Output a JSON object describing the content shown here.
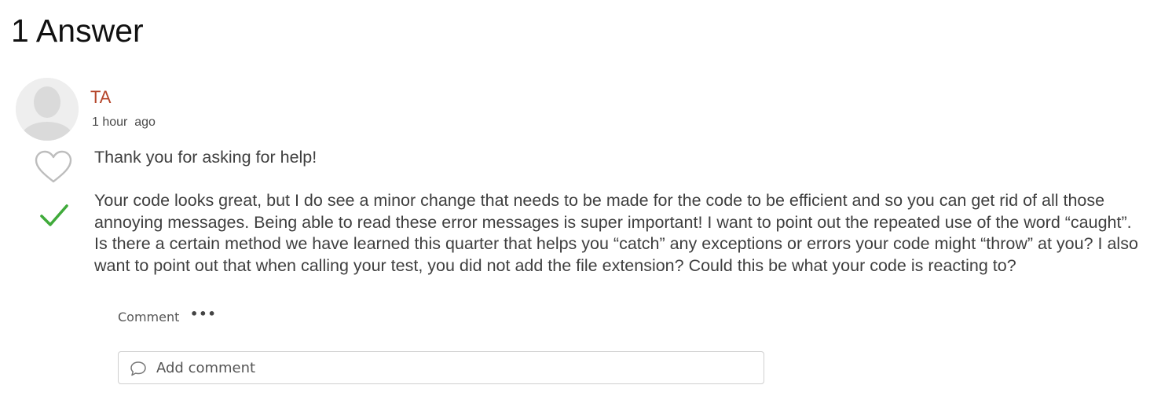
{
  "answers_header": {
    "title": "1 Answer"
  },
  "answer": {
    "author": {
      "name": "TA",
      "avatar_icon": "default-user-avatar"
    },
    "timestamp": "1 hour  ago",
    "actions": {
      "like_icon": "heart-outline-icon",
      "accepted_icon": "checkmark-icon",
      "accepted_color": "#3faa3a"
    },
    "body": {
      "paragraphs": [
        "Thank you for asking for help!",
        "Your code looks great, but I do see a minor change that needs to be made for the code to be efficient and so you can get rid of all those annoying messages. Being able to read these error messages is super important! I want to point out the repeated use of the word “caught”. Is there a certain method we have learned this quarter that helps you “catch” any exceptions or errors your code might “throw” at you? I also want to point out that when calling your test, you did not add the file extension? Could this be what your code is reacting to?"
      ]
    },
    "footer": {
      "comment_label": "Comment",
      "more_label": "•••"
    },
    "add_comment": {
      "icon": "speech-bubble-icon",
      "placeholder": "Add comment"
    }
  },
  "colors": {
    "author_name": "#b5462b",
    "body_text": "#3f3f3f",
    "accepted_check": "#3faa3a"
  }
}
